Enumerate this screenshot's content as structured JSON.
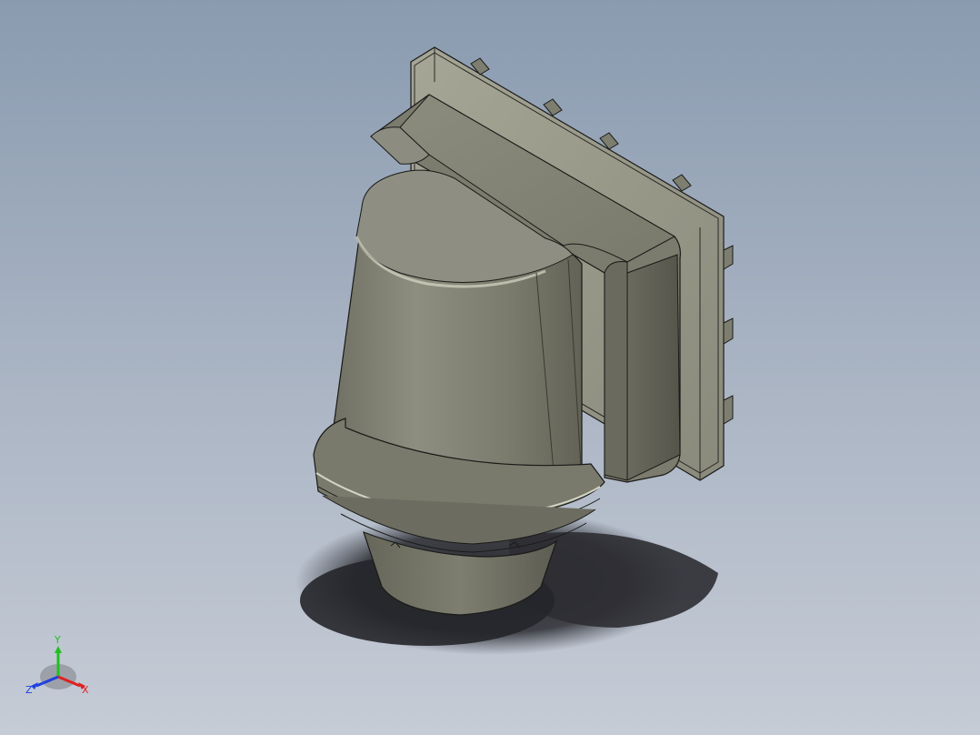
{
  "viewport": {
    "background_top": "#8a9bb0",
    "background_bottom": "#c6ccd6",
    "model_color": "#8a8a7c",
    "shadow_color": "#2a2b2f"
  },
  "triad": {
    "x_label": "X",
    "y_label": "Y",
    "z_label": "Z",
    "x_color": "#e02020",
    "y_color": "#20c020",
    "z_color": "#2040e0"
  }
}
